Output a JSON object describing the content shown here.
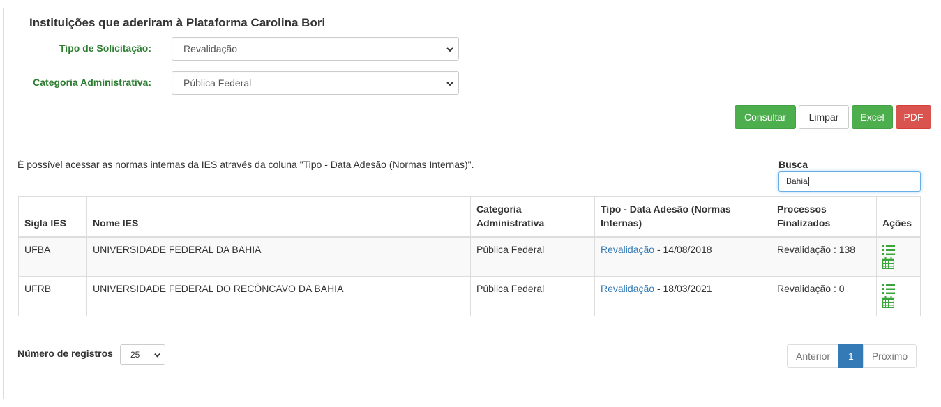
{
  "panel": {
    "title": "Instituições que aderiram à Plataforma Carolina Bori"
  },
  "filters": {
    "tipo_label": "Tipo de Solicitação:",
    "tipo_value": "Revalidação",
    "categoria_label": "Categoria Administrativa:",
    "categoria_value": "Pública Federal"
  },
  "actions": {
    "consultar": "Consultar",
    "limpar": "Limpar",
    "excel": "Excel",
    "pdf": "PDF"
  },
  "note": "É possível acessar as normas internas da IES através da coluna \"Tipo - Data Adesão (Normas Internas)\".",
  "search": {
    "label": "Busca",
    "value": "Bahia"
  },
  "table": {
    "headers": {
      "sigla": "Sigla IES",
      "nome": "Nome IES",
      "categoria_l1": "Categoria",
      "categoria_l2": "Administrativa",
      "tipo_l1": "Tipo - Data Adesão (Normas",
      "tipo_l2": "Internas)",
      "proc_l1": "Processos",
      "proc_l2": "Finalizados",
      "acoes": "Ações"
    },
    "rows": [
      {
        "sigla": "UFBA",
        "nome": "UNIVERSIDADE FEDERAL DA BAHIA",
        "categoria": "Pública Federal",
        "tipo_link": "Revalidação",
        "data": " - 14/08/2018",
        "processos": "Revalidação : 138"
      },
      {
        "sigla": "UFRB",
        "nome": "UNIVERSIDADE FEDERAL DO RECÔNCAVO DA BAHIA",
        "categoria": "Pública Federal",
        "tipo_link": "Revalidação",
        "data": " - 18/03/2021",
        "processos": "Revalidação : 0"
      }
    ]
  },
  "pager": {
    "label": "Número de registros",
    "page_size": "25",
    "prev": "Anterior",
    "current": "1",
    "next": "Próximo"
  },
  "colors": {
    "green_label": "#2e7d32",
    "success": "#4cae4c",
    "danger": "#d9534f",
    "primary": "#337ab7"
  },
  "icons": [
    "list-icon",
    "calendar-icon",
    "chevron-down-icon"
  ]
}
